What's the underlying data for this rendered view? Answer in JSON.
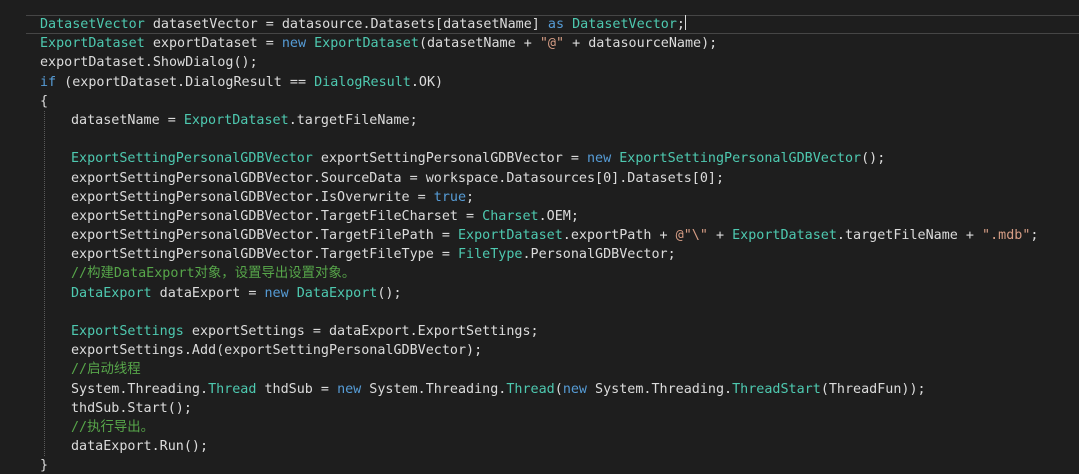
{
  "editor": {
    "colors": {
      "background": "#1e1e1e",
      "keyword": "#569cd6",
      "type": "#4ec9b0",
      "string": "#d69d85",
      "comment": "#57a64a",
      "text": "#dcdcdc"
    },
    "lines": [
      [
        [
          "ty",
          "DatasetVector"
        ],
        [
          "pn",
          " datasetVector = datasource.Datasets[datasetName] "
        ],
        [
          "kw",
          "as"
        ],
        [
          "pn",
          " "
        ],
        [
          "ty",
          "DatasetVector"
        ],
        [
          "pn",
          ";"
        ]
      ],
      [
        [
          "ty",
          "ExportDataset"
        ],
        [
          "pn",
          " exportDataset = "
        ],
        [
          "kw",
          "new"
        ],
        [
          "pn",
          " "
        ],
        [
          "ty",
          "ExportDataset"
        ],
        [
          "pn",
          "(datasetName + "
        ],
        [
          "str",
          "\"@\""
        ],
        [
          "pn",
          " + datasourceName);"
        ]
      ],
      [
        [
          "pn",
          "exportDataset.ShowDialog();"
        ]
      ],
      [
        [
          "kw",
          "if"
        ],
        [
          "pn",
          " (exportDataset.DialogResult == "
        ],
        [
          "ty",
          "DialogResult"
        ],
        [
          "pn",
          ".OK)"
        ]
      ],
      [
        [
          "pn",
          "{"
        ]
      ],
      [
        [
          "pn",
          "datasetName = "
        ],
        [
          "ty",
          "ExportDataset"
        ],
        [
          "pn",
          ".targetFileName;"
        ]
      ],
      [],
      [
        [
          "ty",
          "ExportSettingPersonalGDBVector"
        ],
        [
          "pn",
          " exportSettingPersonalGDBVector = "
        ],
        [
          "kw",
          "new"
        ],
        [
          "pn",
          " "
        ],
        [
          "ty",
          "ExportSettingPersonalGDBVector"
        ],
        [
          "pn",
          "();"
        ]
      ],
      [
        [
          "pn",
          "exportSettingPersonalGDBVector.SourceData = workspace.Datasources[0].Datasets[0];"
        ]
      ],
      [
        [
          "pn",
          "exportSettingPersonalGDBVector.IsOverwrite = "
        ],
        [
          "kw",
          "true"
        ],
        [
          "pn",
          ";"
        ]
      ],
      [
        [
          "pn",
          "exportSettingPersonalGDBVector.TargetFileCharset = "
        ],
        [
          "ty",
          "Charset"
        ],
        [
          "pn",
          ".OEM;"
        ]
      ],
      [
        [
          "pn",
          "exportSettingPersonalGDBVector.TargetFilePath = "
        ],
        [
          "ty",
          "ExportDataset"
        ],
        [
          "pn",
          ".exportPath + "
        ],
        [
          "str",
          "@\"\\\""
        ],
        [
          "pn",
          " + "
        ],
        [
          "ty",
          "ExportDataset"
        ],
        [
          "pn",
          ".targetFileName + "
        ],
        [
          "str",
          "\".mdb\""
        ],
        [
          "pn",
          ";"
        ]
      ],
      [
        [
          "pn",
          "exportSettingPersonalGDBVector.TargetFileType = "
        ],
        [
          "ty",
          "FileType"
        ],
        [
          "pn",
          ".PersonalGDBVector;"
        ]
      ],
      [
        [
          "cm",
          "//构建DataExport对象，设置导出设置对象。"
        ]
      ],
      [
        [
          "ty",
          "DataExport"
        ],
        [
          "pn",
          " dataExport = "
        ],
        [
          "kw",
          "new"
        ],
        [
          "pn",
          " "
        ],
        [
          "ty",
          "DataExport"
        ],
        [
          "pn",
          "();"
        ]
      ],
      [],
      [
        [
          "ty",
          "ExportSettings"
        ],
        [
          "pn",
          " exportSettings = dataExport.ExportSettings;"
        ]
      ],
      [
        [
          "pn",
          "exportSettings.Add(exportSettingPersonalGDBVector);"
        ]
      ],
      [
        [
          "cm",
          "//启动线程"
        ]
      ],
      [
        [
          "pn",
          "System.Threading."
        ],
        [
          "ty",
          "Thread"
        ],
        [
          "pn",
          " thdSub = "
        ],
        [
          "kw",
          "new"
        ],
        [
          "pn",
          " System.Threading."
        ],
        [
          "ty",
          "Thread"
        ],
        [
          "pn",
          "("
        ],
        [
          "kw",
          "new"
        ],
        [
          "pn",
          " System.Threading."
        ],
        [
          "ty",
          "ThreadStart"
        ],
        [
          "pn",
          "(ThreadFun));"
        ]
      ],
      [
        [
          "pn",
          "thdSub.Start();"
        ]
      ],
      [
        [
          "cm",
          "//执行导出。"
        ]
      ],
      [
        [
          "pn",
          "dataExport.Run();"
        ]
      ],
      [
        [
          "pn",
          "}"
        ]
      ]
    ]
  }
}
